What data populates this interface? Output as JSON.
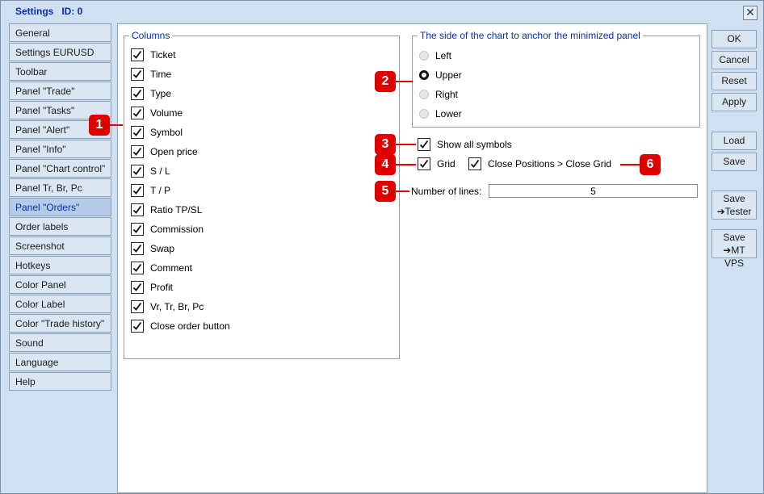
{
  "window": {
    "title": "Settings   ID: 0",
    "close_symbol": "✕"
  },
  "nav": {
    "items": [
      "General",
      "Settings EURUSD",
      "Toolbar",
      "Panel \"Trade\"",
      "Panel \"Tasks\"",
      "Panel \"Alert\"",
      "Panel \"Info\"",
      "Panel \"Chart control\"",
      "Panel Tr, Br, Pc",
      "Panel \"Orders\"",
      "Order labels",
      "Screenshot",
      "Hotkeys",
      "Color Panel",
      "Color Label",
      "Color \"Trade history\"",
      "Sound",
      "Language",
      "Help"
    ],
    "active_index": 9
  },
  "columns": {
    "legend": "Columns",
    "items": [
      {
        "label": "Ticket",
        "checked": true
      },
      {
        "label": "Time",
        "checked": true
      },
      {
        "label": "Type",
        "checked": true
      },
      {
        "label": "Volume",
        "checked": true
      },
      {
        "label": "Symbol",
        "checked": true
      },
      {
        "label": "Open price",
        "checked": true
      },
      {
        "label": "S / L",
        "checked": true
      },
      {
        "label": "T / P",
        "checked": true
      },
      {
        "label": "Ratio TP/SL",
        "checked": true
      },
      {
        "label": "Commission",
        "checked": true
      },
      {
        "label": "Swap",
        "checked": true
      },
      {
        "label": "Comment",
        "checked": true
      },
      {
        "label": "Profit",
        "checked": true
      },
      {
        "label": "Vr, Tr, Br, Pc",
        "checked": true
      },
      {
        "label": "Close order button",
        "checked": true
      }
    ]
  },
  "anchor": {
    "legend": "The side of the chart to anchor the minimized panel",
    "options": [
      "Left",
      "Upper",
      "Right",
      "Lower"
    ],
    "selected_index": 1
  },
  "options": {
    "show_all_symbols": {
      "label": "Show all symbols",
      "checked": true
    },
    "grid": {
      "label": "Grid",
      "checked": true
    },
    "close_positions": {
      "label": "Close Positions > Close Grid",
      "checked": true
    }
  },
  "number_of_lines": {
    "label": "Number of lines:",
    "value": "5"
  },
  "buttons": {
    "ok": "OK",
    "cancel": "Cancel",
    "reset": "Reset",
    "apply": "Apply",
    "load": "Load",
    "save": "Save",
    "save_tester": {
      "line1": "Save",
      "line2": "➔Tester"
    },
    "save_mtvps": {
      "line1": "Save",
      "line2": "➔MT VPS"
    }
  },
  "callouts": [
    "1",
    "2",
    "3",
    "4",
    "5",
    "6"
  ],
  "colors": {
    "accent": "#0b2ea8",
    "callout": "#e10000",
    "background": "#cfe0f3"
  }
}
